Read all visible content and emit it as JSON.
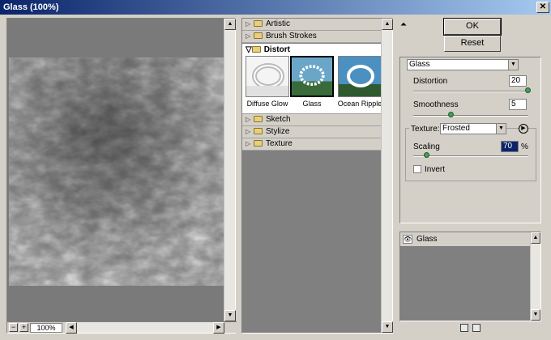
{
  "window": {
    "title": "Glass (100%)"
  },
  "preview": {
    "zoom": "100%",
    "zoom_minus": "−",
    "zoom_plus": "+"
  },
  "gallery": {
    "categories_top": [
      {
        "label": "Artistic"
      },
      {
        "label": "Brush Strokes"
      }
    ],
    "expanded": {
      "label": "Distort",
      "filters": [
        {
          "label": "Diffuse Glow"
        },
        {
          "label": "Glass"
        },
        {
          "label": "Ocean Ripple"
        }
      ]
    },
    "categories_bottom": [
      {
        "label": "Sketch"
      },
      {
        "label": "Stylize"
      },
      {
        "label": "Texture"
      }
    ]
  },
  "actions": {
    "ok": "OK",
    "reset": "Reset"
  },
  "settings": {
    "filter_select": "Glass",
    "distortion": {
      "label": "Distortion",
      "value": "20",
      "fraction": 1.0
    },
    "smoothness": {
      "label": "Smoothness",
      "value": "5",
      "fraction": 0.33
    },
    "texture": {
      "label": "Texture:",
      "value": "Frosted"
    },
    "scaling": {
      "label": "Scaling",
      "value": "70",
      "unit": "%",
      "fraction": 0.12
    },
    "invert": {
      "label": "Invert",
      "checked": false
    }
  },
  "layers": [
    {
      "label": "Glass"
    }
  ],
  "colors": {
    "title_start": "#0a246a",
    "title_end": "#a6caf0",
    "knob": "#4a9a5a",
    "panel": "#d4d0c8"
  }
}
